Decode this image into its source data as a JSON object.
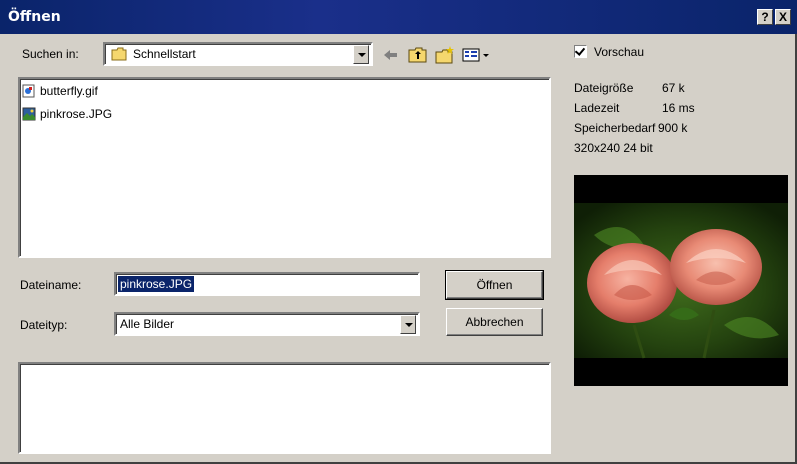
{
  "window": {
    "title": "Öffnen",
    "help_label": "?",
    "close_label": "X"
  },
  "lookin": {
    "label": "Suchen in:",
    "value": "Schnellstart"
  },
  "toolbar": {
    "back_icon": "back-arrow-icon",
    "up_icon": "up-folder-icon",
    "new_folder_icon": "new-folder-icon",
    "view_icon": "view-menu-icon"
  },
  "files": [
    {
      "name": "butterfly.gif",
      "icon": "gif-file-icon"
    },
    {
      "name": "pinkrose.JPG",
      "icon": "jpg-file-icon"
    }
  ],
  "filename": {
    "label": "Dateiname:",
    "value": "pinkrose.JPG"
  },
  "filetype": {
    "label": "Dateityp:",
    "value": "Alle Bilder"
  },
  "buttons": {
    "open": "Öffnen",
    "cancel": "Abbrechen"
  },
  "preview": {
    "checkbox_label": "Vorschau",
    "checked": true,
    "size_label": "Dateigröße",
    "size_value": "67 k",
    "load_label": "Ladezeit",
    "load_value": "16 ms",
    "memory_label": "Speicherbedarf",
    "memory_value": "900 k",
    "dimensions": "320x240 24 bit"
  },
  "colors": {
    "titlebar": "#0a246a",
    "face": "#d4d0c8",
    "selection": "#0a246a"
  }
}
